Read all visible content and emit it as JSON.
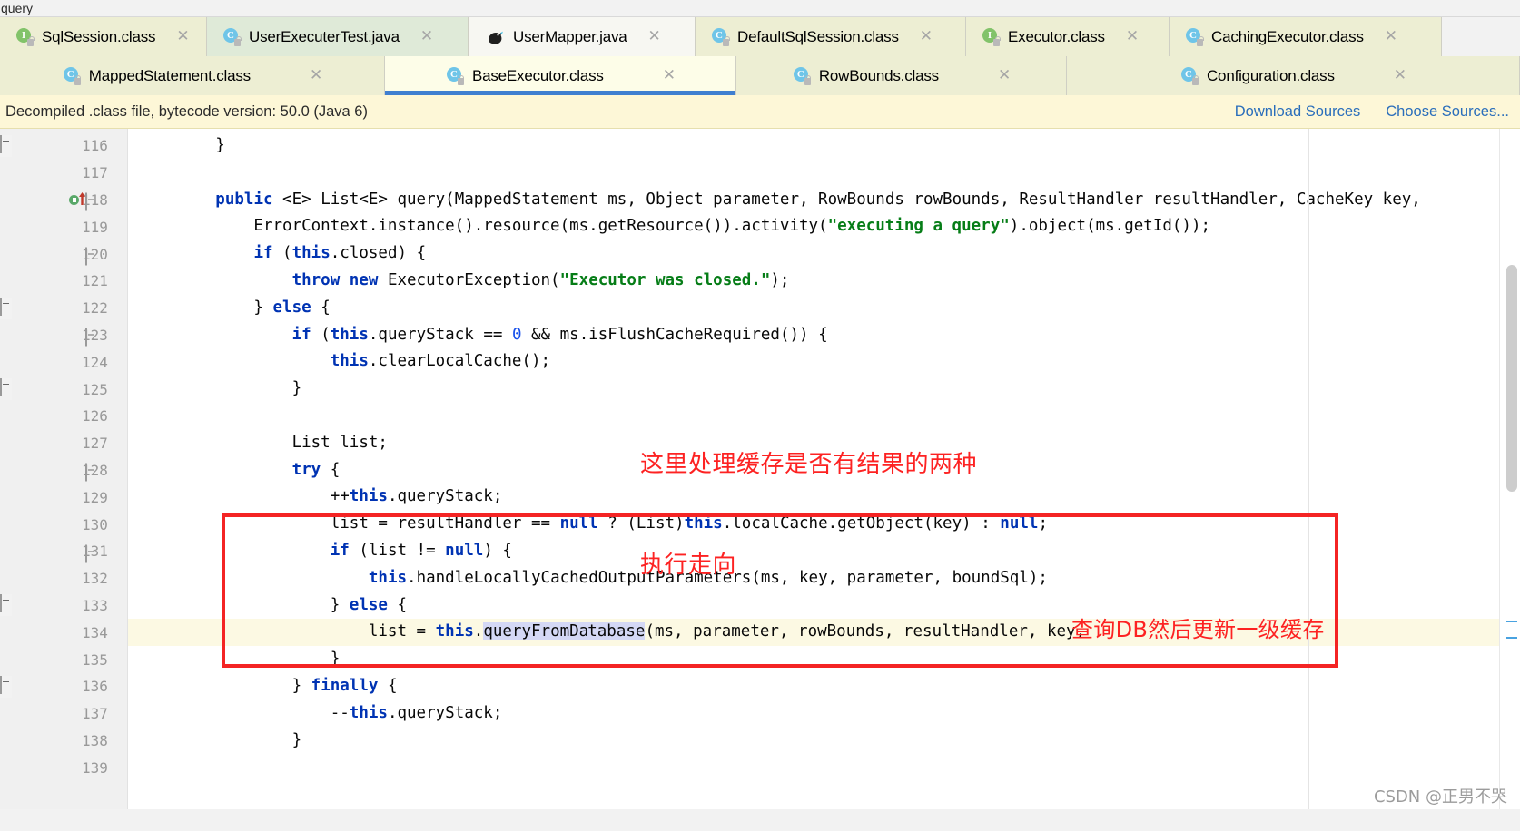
{
  "top_strip": {
    "breadcrumb": "query"
  },
  "tabs_row1": [
    {
      "label": "SqlSession.class",
      "icon": "interface-class-icon",
      "icon_letter": "I",
      "state": "normal",
      "bg": "#edeed3"
    },
    {
      "label": "UserExecuterTest.java",
      "icon": "java-class-icon",
      "icon_letter": "C",
      "state": "greenish",
      "bg": "#dfead8"
    },
    {
      "label": "UserMapper.java",
      "icon": "mybatis-bird-icon",
      "icon_letter": "",
      "state": "active",
      "bg": "#f7f7f2"
    },
    {
      "label": "DefaultSqlSession.class",
      "icon": "java-class-icon",
      "icon_letter": "C",
      "state": "normal",
      "bg": "#edeed3"
    },
    {
      "label": "Executor.class",
      "icon": "interface-class-icon",
      "icon_letter": "I",
      "state": "normal",
      "bg": "#edeed3"
    },
    {
      "label": "CachingExecutor.class",
      "icon": "java-class-icon",
      "icon_letter": "C",
      "state": "normal",
      "bg": "#edeed3"
    }
  ],
  "tabs_row2": [
    {
      "label": "MappedStatement.class",
      "icon": "java-class-icon",
      "icon_letter": "C",
      "state": "normal",
      "bg": "#edeed3"
    },
    {
      "label": "BaseExecutor.class",
      "icon": "java-class-icon",
      "icon_letter": "C",
      "state": "selected",
      "bg": "#fdfde8"
    },
    {
      "label": "RowBounds.class",
      "icon": "java-class-icon",
      "icon_letter": "C",
      "state": "normal",
      "bg": "#edeed3"
    },
    {
      "label": "Configuration.class",
      "icon": "java-class-icon",
      "icon_letter": "C",
      "state": "normal",
      "bg": "#edeed3"
    }
  ],
  "notification": {
    "message": "Decompiled .class file, bytecode version: 50.0 (Java 6)",
    "download_sources": "Download Sources",
    "choose_sources": "Choose Sources..."
  },
  "gutter": {
    "lines": [
      {
        "num": "116",
        "fold": "bottom",
        "run": false
      },
      {
        "num": "117",
        "fold": "none",
        "run": false
      },
      {
        "num": "118",
        "fold": "top",
        "run": true
      },
      {
        "num": "119",
        "fold": "none",
        "run": false
      },
      {
        "num": "120",
        "fold": "top",
        "run": false
      },
      {
        "num": "121",
        "fold": "none",
        "run": false
      },
      {
        "num": "122",
        "fold": "bottom",
        "run": false
      },
      {
        "num": "123",
        "fold": "top",
        "run": false
      },
      {
        "num": "124",
        "fold": "none",
        "run": false
      },
      {
        "num": "125",
        "fold": "bottom",
        "run": false
      },
      {
        "num": "126",
        "fold": "none",
        "run": false
      },
      {
        "num": "127",
        "fold": "none",
        "run": false
      },
      {
        "num": "128",
        "fold": "top",
        "run": false
      },
      {
        "num": "129",
        "fold": "none",
        "run": false
      },
      {
        "num": "130",
        "fold": "none",
        "run": false
      },
      {
        "num": "131",
        "fold": "top",
        "run": false
      },
      {
        "num": "132",
        "fold": "none",
        "run": false
      },
      {
        "num": "133",
        "fold": "bottom",
        "run": false
      },
      {
        "num": "134",
        "fold": "none",
        "run": false
      },
      {
        "num": "135",
        "fold": "none",
        "run": false
      },
      {
        "num": "136",
        "fold": "bottom",
        "run": false
      },
      {
        "num": "137",
        "fold": "none",
        "run": false
      },
      {
        "num": "138",
        "fold": "none",
        "run": false
      },
      {
        "num": "139",
        "fold": "none",
        "run": false
      }
    ]
  },
  "code": {
    "line_116": "        }",
    "line_117": "",
    "line_118_pre": "        ",
    "line_118_kw1": "public",
    "line_118_mid": " <E> List<E> query(MappedStatement ms, Object parameter, RowBounds rowBounds, ResultHandler resultHandler, CacheKey key,",
    "line_119": "            ErrorContext.instance().resource(ms.getResource()).activity(",
    "line_119_str": "\"executing a query\"",
    "line_119_end": ").object(ms.getId());",
    "line_120_a": "            ",
    "line_120_if": "if",
    "line_120_b": " (",
    "line_120_this": "this",
    "line_120_c": ".closed) {",
    "line_121_a": "                ",
    "line_121_kw": "throw new",
    "line_121_b": " ExecutorException(",
    "line_121_str": "\"Executor was closed.\"",
    "line_121_c": ");",
    "line_122_a": "            } ",
    "line_122_kw": "else",
    "line_122_b": " {",
    "line_123_a": "                ",
    "line_123_if": "if",
    "line_123_b": " (",
    "line_123_this": "this",
    "line_123_c": ".queryStack == ",
    "line_123_zero": "0",
    "line_123_d": " && ms.isFlushCacheRequired()) {",
    "line_124_a": "                    ",
    "line_124_this": "this",
    "line_124_b": ".clearLocalCache();",
    "line_125": "                }",
    "line_126": "",
    "line_127": "                List list;",
    "line_128_a": "                ",
    "line_128_kw": "try",
    "line_128_b": " {",
    "line_129_a": "                    ++",
    "line_129_this": "this",
    "line_129_b": ".queryStack;",
    "line_130_a": "                    list = resultHandler == ",
    "line_130_null": "null",
    "line_130_b": " ? (List)",
    "line_130_this": "this",
    "line_130_c": ".localCache.getObject(key) : ",
    "line_130_null2": "null",
    "line_130_d": ";",
    "line_131_a": "                    ",
    "line_131_if": "if",
    "line_131_b": " (list != ",
    "line_131_null": "null",
    "line_131_c": ") {",
    "line_132_a": "                        ",
    "line_132_this": "this",
    "line_132_b": ".handleLocallyCachedOutputParameters(ms, key, parameter, boundSql);",
    "line_133_a": "                    } ",
    "line_133_kw": "else",
    "line_133_b": " {",
    "line_134_a": "                        list = ",
    "line_134_this": "this",
    "line_134_dot": ".",
    "line_134_sel1": "queryFromDa",
    "line_134_sel2": "tabase",
    "line_134_b": "(ms, parameter, rowBounds, resultHandler, key,",
    "line_135": "                    }",
    "line_136_a": "                } ",
    "line_136_kw": "finally",
    "line_136_b": " {",
    "line_137_a": "                    --",
    "line_137_this": "this",
    "line_137_b": ".queryStack;",
    "line_138": "                }"
  },
  "annotations": {
    "note_line1": "这里处理缓存是否有结果的两种",
    "note_line2": "执行走向",
    "note_inline": "查询DB然后更新一级缓存"
  },
  "watermark": {
    "text": "CSDN @正男不哭"
  },
  "colors": {
    "keyword": "#0033b3",
    "string": "#067d17",
    "annotation_red": "#fd2222",
    "tab_selected_underline": "#3f7fd0",
    "notification_bg": "#fdf7d7",
    "link": "#2a6ebb"
  }
}
